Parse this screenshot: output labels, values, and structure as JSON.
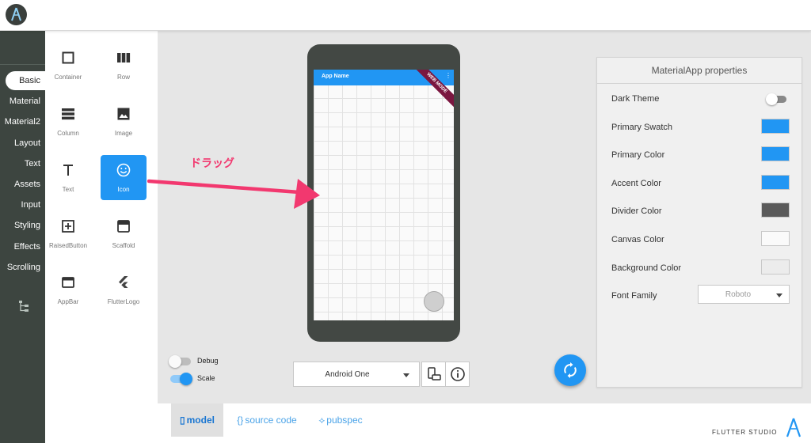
{
  "categories": [
    "Basic",
    "Material",
    "Material2",
    "Layout",
    "Text",
    "Assets",
    "Input",
    "Styling",
    "Effects",
    "Scrolling"
  ],
  "active_category": "Basic",
  "palette": [
    {
      "label": "Container",
      "icon": "square-outline-icon"
    },
    {
      "label": "Row",
      "icon": "row-columns-icon"
    },
    {
      "label": "Column",
      "icon": "column-rows-icon"
    },
    {
      "label": "Image",
      "icon": "image-icon"
    },
    {
      "label": "Text",
      "icon": "text-t-icon"
    },
    {
      "label": "Icon",
      "icon": "smiley-face-icon"
    },
    {
      "label": "RaisedButton",
      "icon": "plus-box-icon"
    },
    {
      "label": "Scaffold",
      "icon": "scaffold-icon"
    },
    {
      "label": "AppBar",
      "icon": "appbar-icon"
    },
    {
      "label": "FlutterLogo",
      "icon": "flutter-logo-icon"
    }
  ],
  "selected_palette_item": "Icon",
  "annotation": {
    "drag_text": "ドラッグ",
    "color": "#f2386f"
  },
  "phone": {
    "app_name": "App Name",
    "ribbon": "WEB MODE",
    "menu_glyph": "⋮",
    "appbar_color": "#2196f3"
  },
  "properties": {
    "title": "MaterialApp properties",
    "rows": [
      {
        "label": "Dark Theme",
        "type": "toggle",
        "value": false
      },
      {
        "label": "Primary Swatch",
        "type": "color",
        "value": "#2196f3"
      },
      {
        "label": "Primary Color",
        "type": "color",
        "value": "#2196f3"
      },
      {
        "label": "Accent Color",
        "type": "color",
        "value": "#2196f3"
      },
      {
        "label": "Divider Color",
        "type": "color",
        "value": "#5a5a5a"
      },
      {
        "label": "Canvas Color",
        "type": "color",
        "value": "#fafafa"
      },
      {
        "label": "Background Color",
        "type": "color",
        "value": "#ececec"
      },
      {
        "label": "Font Family",
        "type": "select",
        "value": "Roboto"
      }
    ]
  },
  "controls": {
    "debug_label": "Debug",
    "debug_on": false,
    "scale_label": "Scale",
    "scale_on": true,
    "device": "Android One"
  },
  "bottom_tabs": [
    {
      "label": "model",
      "glyph": "▯",
      "active": true
    },
    {
      "label": "source code",
      "glyph": "{}",
      "active": false
    },
    {
      "label": "pubspec",
      "glyph": "⟡",
      "active": false
    }
  ],
  "brand": "FLUTTER STUDIO",
  "colors": {
    "accent": "#2196f3",
    "sidebar": "#3d4540"
  }
}
